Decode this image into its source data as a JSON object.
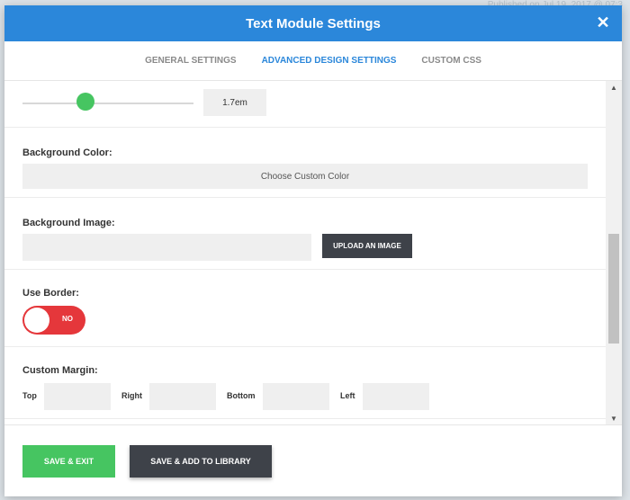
{
  "background": {
    "text": "Published on Jul 19, 2017 @ 07:3"
  },
  "modal": {
    "title": "Text Module Settings",
    "close_icon": "close-icon"
  },
  "tabs": [
    {
      "label": "General Settings",
      "active": false
    },
    {
      "label": "Advanced Design Settings",
      "active": true
    },
    {
      "label": "Custom CSS",
      "active": false
    }
  ],
  "slider": {
    "value_text": "1.7em",
    "level": 0.35
  },
  "background_color": {
    "label": "Background Color:",
    "button_label": "Choose Custom Color"
  },
  "background_image": {
    "label": "Background Image:",
    "input_value": "",
    "upload_label": "Upload an Image"
  },
  "use_border": {
    "label": "Use Border:",
    "toggle_text": "NO",
    "enabled": false
  },
  "custom_margin": {
    "label": "Custom Margin:",
    "fields": [
      {
        "label": "Top",
        "value": ""
      },
      {
        "label": "Right",
        "value": ""
      },
      {
        "label": "Bottom",
        "value": ""
      },
      {
        "label": "Left",
        "value": ""
      }
    ]
  },
  "footer": {
    "save_exit_label": "Save & Exit",
    "save_library_label": "Save & Add To Library"
  },
  "colors": {
    "header": "#2b87da",
    "active_tab": "#2b87da",
    "slider_handle": "#46c561",
    "save_button": "#46c561",
    "dark_button": "#3e4249",
    "toggle_off": "#e5373b"
  }
}
